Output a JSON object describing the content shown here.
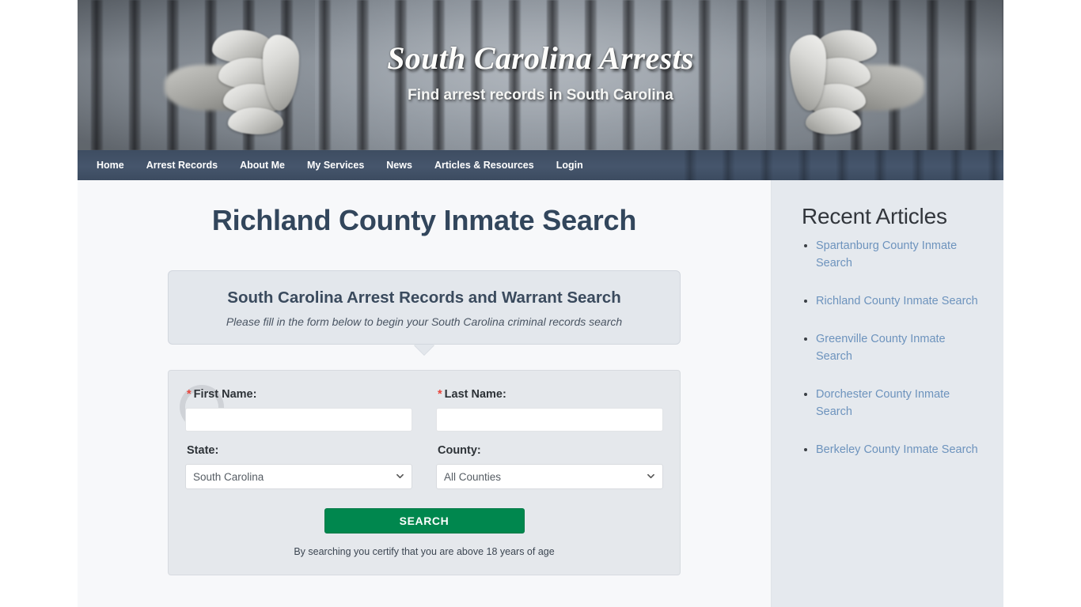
{
  "banner": {
    "title": "South Carolina Arrests",
    "tagline": "Find arrest records in South Carolina"
  },
  "nav": {
    "items": [
      {
        "label": "Home"
      },
      {
        "label": "Arrest Records"
      },
      {
        "label": "About Me"
      },
      {
        "label": "My Services"
      },
      {
        "label": "News"
      },
      {
        "label": "Articles & Resources"
      },
      {
        "label": "Login"
      }
    ]
  },
  "main": {
    "page_title": "Richland County Inmate Search",
    "bubble": {
      "title": "South Carolina Arrest Records and Warrant Search",
      "subtitle": "Please fill in the form below to begin your South Carolina criminal records search"
    },
    "form": {
      "first_name": {
        "label": "First Name:",
        "required_marker": "*",
        "value": "",
        "placeholder": ""
      },
      "last_name": {
        "label": "Last Name:",
        "required_marker": "*",
        "value": "",
        "placeholder": ""
      },
      "state": {
        "label": "State:",
        "selected": "South Carolina",
        "options": [
          "South Carolina"
        ]
      },
      "county": {
        "label": "County:",
        "selected": "All Counties",
        "options": [
          "All Counties"
        ]
      },
      "submit_label": "SEARCH",
      "disclaimer": "By searching you certify that you are above 18 years of age"
    }
  },
  "sidebar": {
    "title": "Recent Articles",
    "links": [
      {
        "label": "Spartanburg County Inmate Search"
      },
      {
        "label": "Richland County Inmate Search"
      },
      {
        "label": "Greenville County Inmate Search"
      },
      {
        "label": "Dorchester County Inmate Search"
      },
      {
        "label": "Berkeley County Inmate Search"
      }
    ]
  },
  "colors": {
    "nav_background": "#36496180",
    "heading": "#32465c",
    "accent_green": "#00874e",
    "link_blue": "#6d93bd",
    "required_red": "#e8453c",
    "sidebar_background": "#e5e9ee",
    "panel_background": "#e5e8ec"
  }
}
